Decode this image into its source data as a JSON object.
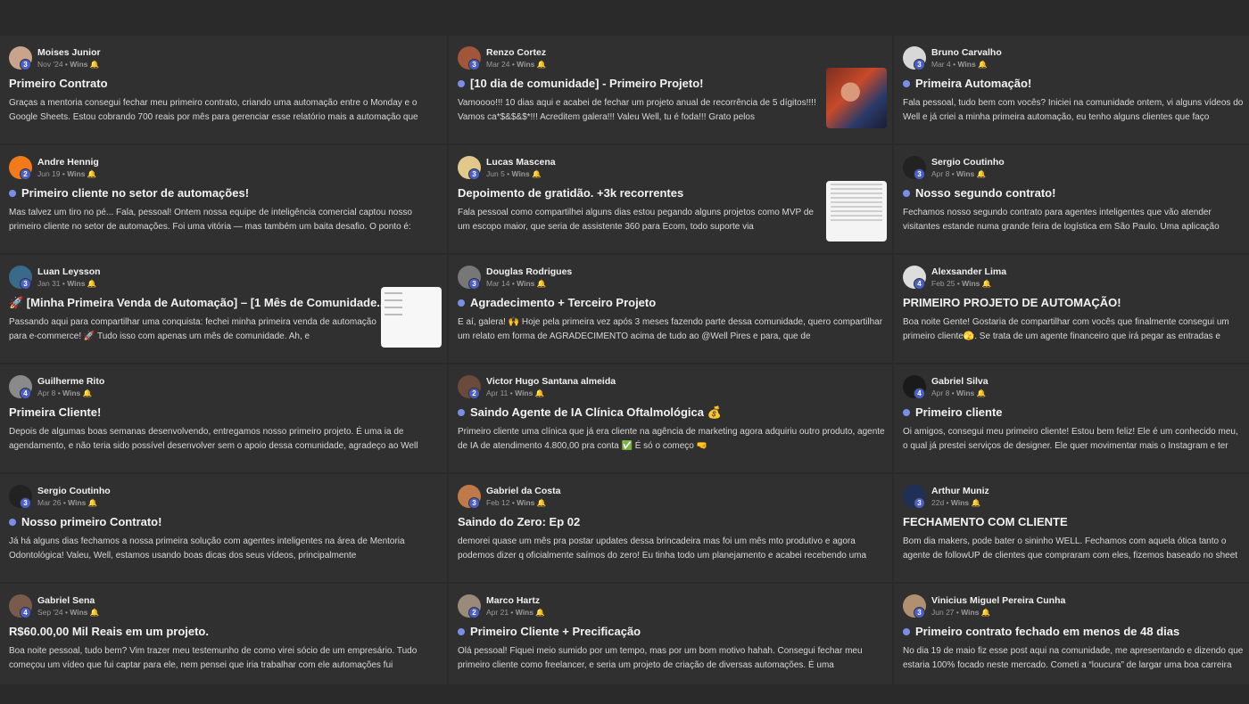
{
  "posts": [
    {
      "author": "Moises Junior",
      "level": "3",
      "date": "Nov '24",
      "category": "Wins",
      "title": "Primeiro Contrato",
      "dot": false,
      "body": "Graças a mentoria consegui fechar meu primeiro contrato, criando uma automação entre o Monday e o Google Sheets. Estou cobrando 700 reais por mês para gerenciar esse relatório mais a automação que",
      "avatar_color": "#c9a38c",
      "thumb": ""
    },
    {
      "author": "Renzo Cortez",
      "level": "3",
      "date": "Mar 24",
      "category": "Wins",
      "title": "[10 dia de comunidade] - Primeiro Projeto!",
      "dot": true,
      "body": "Vamoooo!!! 10 dias aqui e acabei de fechar um projeto anual de recorrência de 5 dígitos!!!! Vamos ca*$&$&$*!!! Acreditem galera!!! Valeu Well, tu é foda!!! Grato pelos",
      "avatar_color": "#a0563b",
      "thumb": "photo"
    },
    {
      "author": "Bruno Carvalho",
      "level": "3",
      "date": "Mar 4",
      "category": "Wins",
      "title": "Primeira Automação!",
      "dot": true,
      "body": "Fala pessoal, tudo bem com vocês? Iniciei na comunidade ontem, vi alguns vídeos do Well e já criei a minha primeira automação, eu tenho alguns clientes que faço marketing digital",
      "avatar_color": "#d8d8d8",
      "thumb": ""
    },
    {
      "author": "Andre Hennig",
      "level": "2",
      "date": "Jun 19",
      "category": "Wins",
      "title": "Primeiro cliente no setor de automações!",
      "dot": true,
      "body": "Mas talvez um tiro no pé... Fala, pessoal! Ontem nossa equipe de inteligência comercial captou nosso primeiro cliente no setor de automações. Foi uma vitória — mas também um baita desafio. O ponto é:",
      "avatar_color": "#f27a1a",
      "thumb": ""
    },
    {
      "author": "Lucas Mascena",
      "level": "3",
      "date": "Jun 5",
      "category": "Wins",
      "title": "Depoimento de gratidão. +3k recorrentes",
      "dot": false,
      "body": "Fala pessoal como compartilhei alguns dias estou pegando alguns projetos como MVP de um escopo maior, que seria de assistente 360 para Ecom, todo suporte via",
      "avatar_color": "#e0c98a",
      "thumb": "doc"
    },
    {
      "author": "Sergio Coutinho",
      "level": "3",
      "date": "Apr 8",
      "category": "Wins",
      "title": "Nosso segundo contrato!",
      "dot": true,
      "body": "Fechamos nosso segundo contrato para agentes inteligentes que vão atender visitantes estande numa grande feira de logística em São Paulo. Uma aplicação pontual que pode",
      "avatar_color": "#222222",
      "thumb": ""
    },
    {
      "author": "Luan Leysson",
      "level": "3",
      "date": "Jan 31",
      "category": "Wins",
      "title": "🚀 [Minha Primeira Venda de Automação] – [1 Mês de Comunidade...",
      "dot": false,
      "body": "Passando aqui para compartilhar uma conquista: fechei minha primeira venda de automação para e-commerce! 🚀 Tudo isso com apenas um mês de comunidade. Ah, e",
      "avatar_color": "#3a6a8a",
      "thumb": "white"
    },
    {
      "author": "Douglas Rodrigues",
      "level": "3",
      "date": "Mar 14",
      "category": "Wins",
      "title": "Agradecimento + Terceiro Projeto",
      "dot": true,
      "body": "E aí, galera! 🙌 Hoje pela primeira vez após 3 meses fazendo parte dessa comunidade, quero compartilhar um relato em forma de AGRADECIMENTO acima de tudo ao @Well Pires e para, que de",
      "avatar_color": "#777777",
      "thumb": ""
    },
    {
      "author": "Alexsander Lima",
      "level": "4",
      "date": "Feb 25",
      "category": "Wins",
      "title": "PRIMEIRO PROJETO DE AUTOMAÇÃO!",
      "dot": false,
      "body": "Boa noite Gente! Gostaria de compartilhar com vocês que finalmente consegui um primeiro cliente🫣. Se trata de um agente financeiro que irá pegar as entradas e saídas do usuário",
      "avatar_color": "#dddddd",
      "thumb": ""
    },
    {
      "author": "Guilherme Rito",
      "level": "4",
      "date": "Apr 8",
      "category": "Wins",
      "title": "Primeira Cliente!",
      "dot": false,
      "body": "Depois de algumas boas semanas desenvolvendo, entregamos nosso primeiro projeto. É uma ia de agendamento, e não teria sido possível desenvolver sem o apoio dessa comunidade, agradeço ao Well",
      "avatar_color": "#8a8a8a",
      "thumb": ""
    },
    {
      "author": "Victor Hugo Santana almeida",
      "level": "2",
      "date": "Apr 11",
      "category": "Wins",
      "title": "Saindo Agente de IA Clínica Oftalmológica 💰",
      "dot": true,
      "body": "Primeiro cliente uma clínica que já era cliente na agência de marketing agora adquiriu outro produto, agente de IA de atendimento 4.800,00 pra conta ✅ É só o começo 🤜",
      "avatar_color": "#6a4a3a",
      "thumb": ""
    },
    {
      "author": "Gabriel Silva",
      "level": "4",
      "date": "Apr 8",
      "category": "Wins",
      "title": "Primeiro cliente",
      "dot": true,
      "body": "Oi amigos, consegui meu primeiro cliente! Estou bem feliz! Ele é um conhecido meu, o qual já prestei serviços de designer. Ele quer movimentar mais o Instagram e ter controle",
      "avatar_color": "#1a1a1a",
      "thumb": ""
    },
    {
      "author": "Sergio Coutinho",
      "level": "3",
      "date": "Mar 26",
      "category": "Wins",
      "title": "Nosso primeiro Contrato!",
      "dot": true,
      "body": "Já há alguns dias fechamos a nossa primeira solução com agentes inteligentes na área de Mentoria Odontológica! Valeu, Well, estamos usando boas dicas dos seus vídeos, principalmente",
      "avatar_color": "#222222",
      "thumb": ""
    },
    {
      "author": "Gabriel da Costa",
      "level": "3",
      "date": "Feb 12",
      "category": "Wins",
      "title": "Saindo do Zero: Ep 02",
      "dot": false,
      "body": "demorei quase um mês pra postar updates dessa brincadeira mas foi um mês mto produtivo e agora podemos dizer q oficialmente saímos do zero! Eu tinha todo um planejamento e acabei recebendo uma",
      "avatar_color": "#c07a4a",
      "thumb": ""
    },
    {
      "author": "Arthur Muniz",
      "level": "3",
      "date": "22d",
      "category": "Wins",
      "title": "FECHAMENTO COM CLIENTE",
      "dot": false,
      "body": "Bom dia makers, pode bater o sininho WELL. Fechamos com aquela ótica tanto o agente de followUP de clientes que compraram com eles, fizemos baseado no sheet mesmo",
      "avatar_color": "#1f2f55",
      "thumb": ""
    },
    {
      "author": "Gabriel Sena",
      "level": "4",
      "date": "Sep '24",
      "category": "Wins",
      "title": "R$60.00,00 Mil Reais em um projeto.",
      "dot": false,
      "body": "Boa noite pessoal, tudo bem? Vim trazer meu testemunho de como virei sócio de um empresário. Tudo começou um vídeo que fui captar para ele, nem pensei que iria trabalhar com ele automações fui",
      "avatar_color": "#7a5a4a",
      "thumb": ""
    },
    {
      "author": "Marco Hartz",
      "level": "2",
      "date": "Apr 21",
      "category": "Wins",
      "title": "Primeiro Cliente + Precificação",
      "dot": true,
      "body": "Olá pessoal! Fiquei meio sumido por um tempo, mas por um bom motivo hahah. Consegui fechar meu primeiro cliente como freelancer, e seria um projeto de criação de diversas automações. É uma",
      "avatar_color": "#9a8a7a",
      "thumb": ""
    },
    {
      "author": "Vinicius Miguel Pereira Cunha",
      "level": "3",
      "date": "Jun 27",
      "category": "Wins",
      "title": "Primeiro contrato fechado em menos de 48 dias",
      "dot": true,
      "body": "No dia 19 de maio fiz esse post aqui na comunidade, me apresentando e dizendo que estaria 100% focado neste mercado. Cometi a “loucura” de largar uma boa carreira",
      "avatar_color": "#b09070",
      "thumb": ""
    }
  ]
}
